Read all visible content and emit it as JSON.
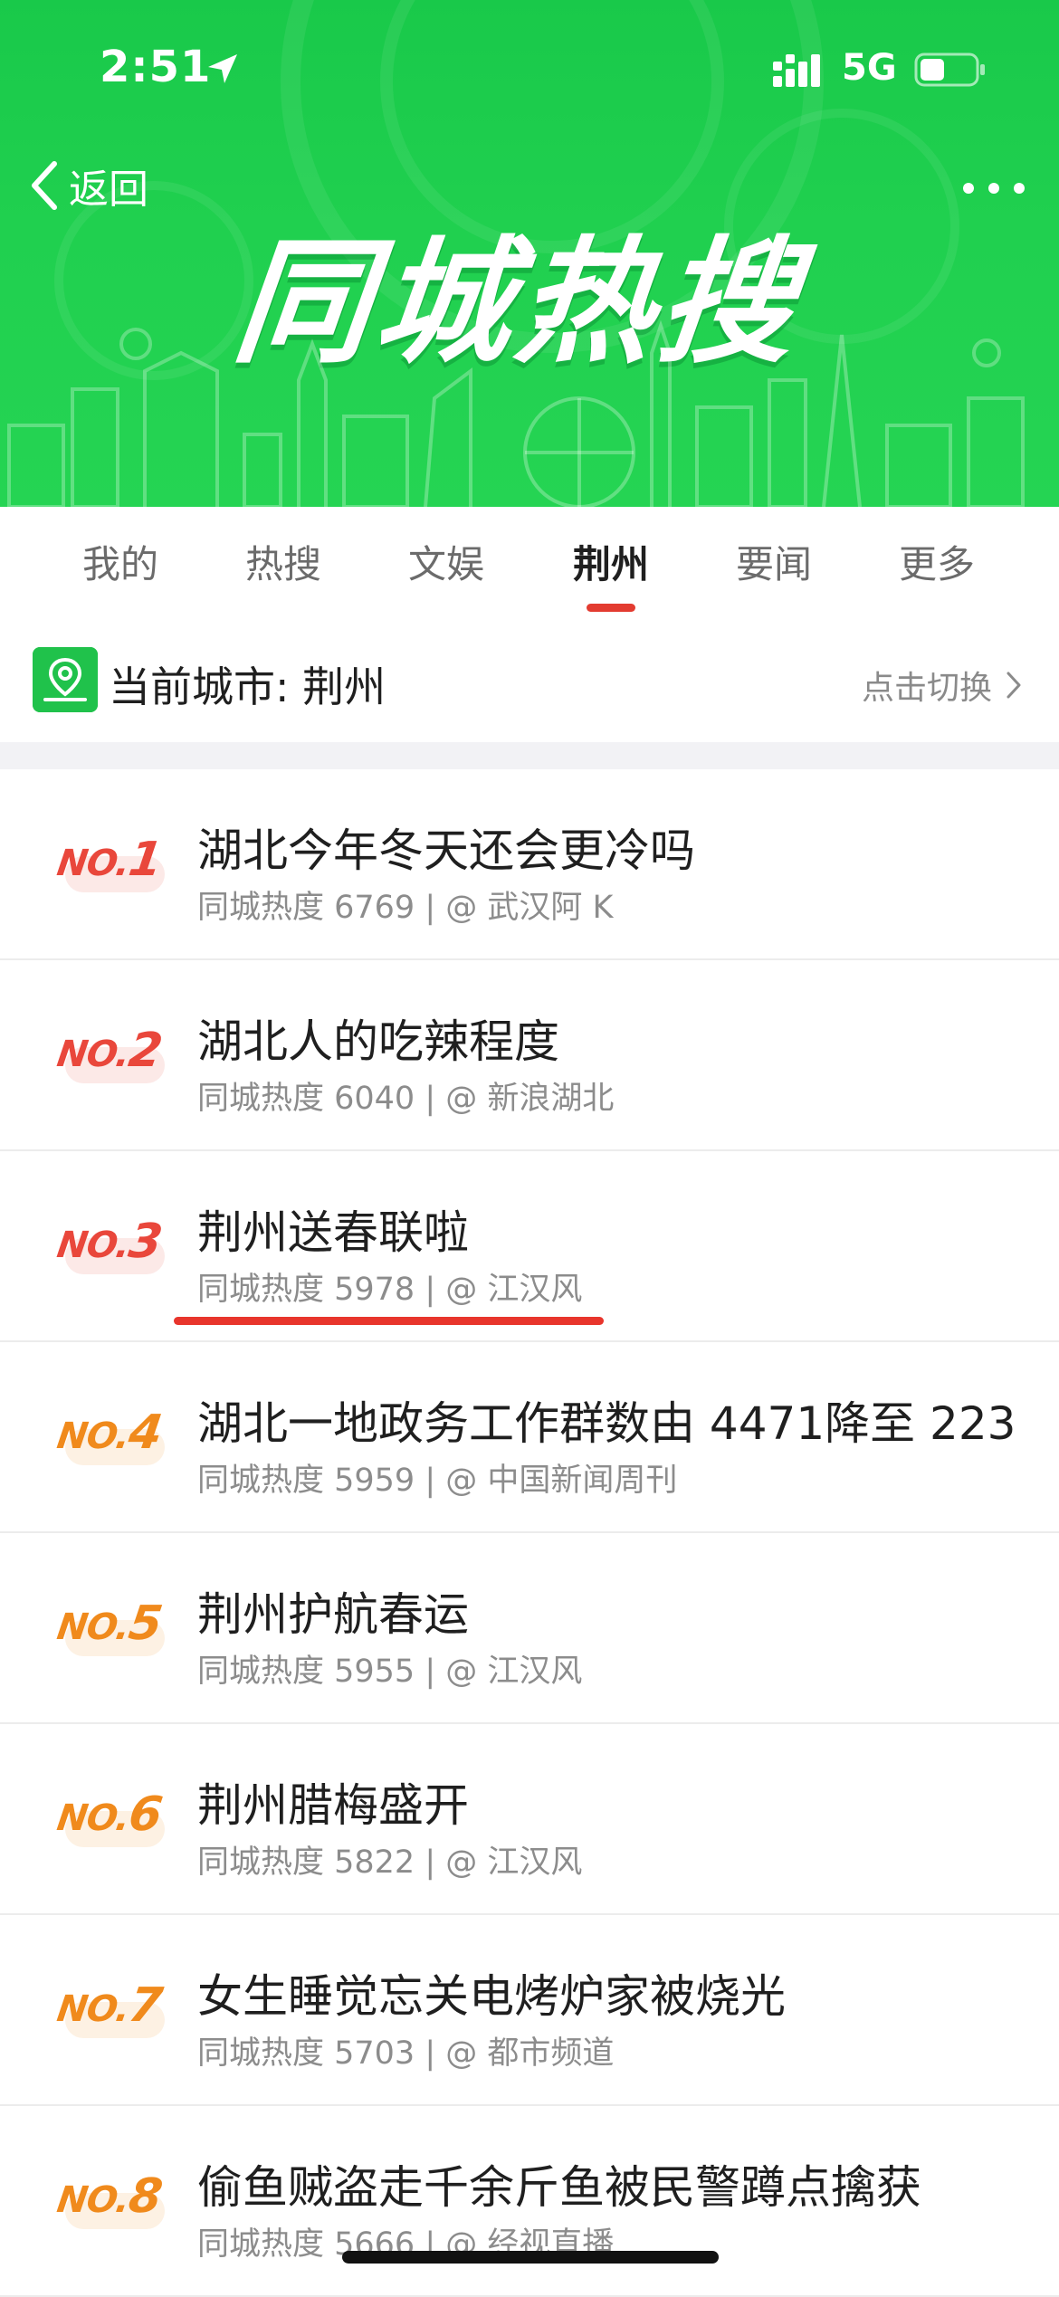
{
  "status_bar": {
    "time": "2:51",
    "network": "5G"
  },
  "header": {
    "back_label": "返回",
    "hero_title": "同城热搜",
    "accent_color": "#20d04f"
  },
  "tabs": [
    {
      "label": "我的"
    },
    {
      "label": "热搜"
    },
    {
      "label": "文娱"
    },
    {
      "label": "荆州",
      "active": true
    },
    {
      "label": "要闻"
    },
    {
      "label": "更多"
    }
  ],
  "city": {
    "label": "当前城市: 荆州",
    "switch_label": "点击切换"
  },
  "list": [
    {
      "rank_prefix": "NO.",
      "rank_num": "1",
      "title": "湖北今年冬天还会更冷吗",
      "meta": "同城热度 6769 | @ 武汉阿 K",
      "color": "#e9473b"
    },
    {
      "rank_prefix": "NO.",
      "rank_num": "2",
      "title": "湖北人的吃辣程度",
      "meta": "同城热度 6040 | @ 新浪湖北",
      "color": "#e9473b"
    },
    {
      "rank_prefix": "NO.",
      "rank_num": "3",
      "title": "荆州送春联啦",
      "meta": "同城热度 5978 | @ 江汉风",
      "color": "#e9473b"
    },
    {
      "rank_prefix": "NO.",
      "rank_num": "4",
      "title": "湖北一地政务工作群数由 4471降至 223",
      "meta": "同城热度 5959 | @ 中国新闻周刊",
      "color": "#f08a1c"
    },
    {
      "rank_prefix": "NO.",
      "rank_num": "5",
      "title": "荆州护航春运",
      "meta": "同城热度 5955 | @ 江汉风",
      "color": "#f08a1c"
    },
    {
      "rank_prefix": "NO.",
      "rank_num": "6",
      "title": "荆州腊梅盛开",
      "meta": "同城热度 5822 | @ 江汉风",
      "color": "#f08a1c"
    },
    {
      "rank_prefix": "NO.",
      "rank_num": "7",
      "title": "女生睡觉忘关电烤炉家被烧光",
      "meta": "同城热度 5703 | @ 都市频道",
      "color": "#f08a1c"
    },
    {
      "rank_prefix": "NO.",
      "rank_num": "8",
      "title": "偷鱼贼盗走千余斤鱼被民警蹲点擒获",
      "meta": "同城热度 5666 | @ 经视直播",
      "color": "#f08a1c"
    }
  ]
}
